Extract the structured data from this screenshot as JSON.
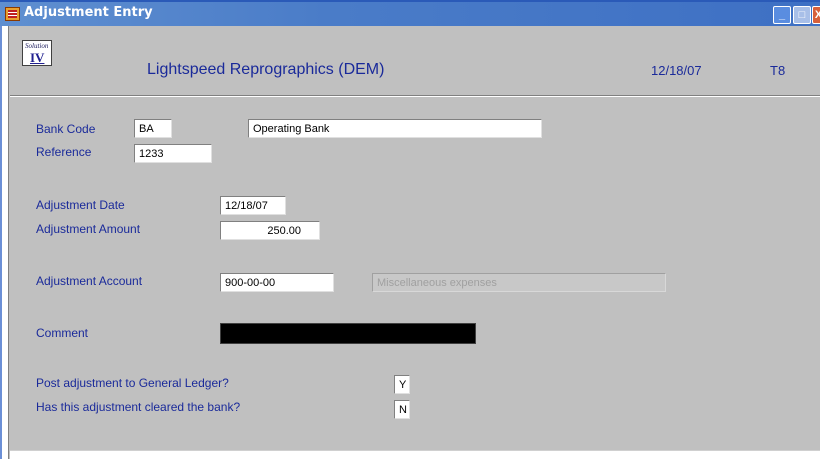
{
  "window": {
    "title": "Adjustment Entry",
    "min_glyph": "_",
    "max_glyph": "□",
    "close_glyph": "X"
  },
  "header": {
    "logo_top": "Solution",
    "logo_num": "IV",
    "company": "Lightspeed Reprographics (DEM)",
    "date": "12/18/07",
    "terminal": "T8"
  },
  "form": {
    "bank_code": {
      "label": "Bank Code",
      "value": "BA",
      "description": "Operating Bank"
    },
    "reference": {
      "label": "Reference",
      "value": "1233"
    },
    "adjustment_date": {
      "label": "Adjustment Date",
      "value": "12/18/07"
    },
    "adjustment_amount": {
      "label": "Adjustment Amount",
      "value": "250.00"
    },
    "adjustment_account": {
      "label": "Adjustment Account",
      "value": "900-00-00",
      "description": "Miscellaneous expenses"
    },
    "comment": {
      "label": "Comment",
      "value": ""
    },
    "post_to_gl": {
      "label": "Post adjustment to General Ledger?",
      "value": "Y"
    },
    "cleared_bank": {
      "label": "Has this adjustment cleared the bank?",
      "value": "N"
    }
  },
  "colors": {
    "label_text": "#1a2a9a",
    "titlebar": "#4a7cc8",
    "background": "#c0c0c0"
  }
}
